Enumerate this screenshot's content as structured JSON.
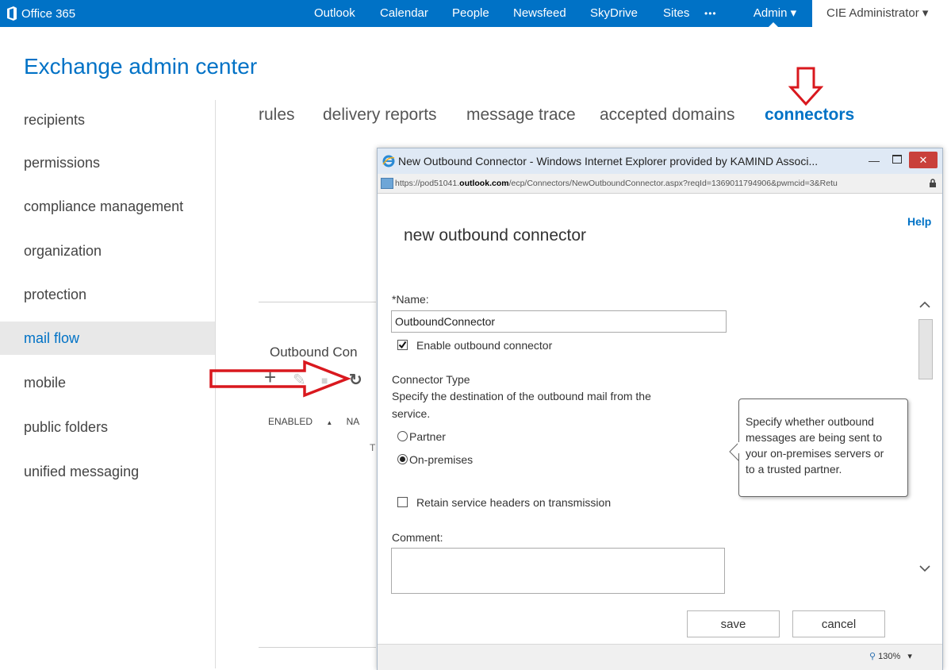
{
  "topbar": {
    "brand": "Office 365",
    "nav": [
      "Outlook",
      "Calendar",
      "People",
      "Newsfeed",
      "SkyDrive",
      "Sites",
      "•••"
    ],
    "admin_label": "Admin ▾",
    "user": "CIE Administrator ▾",
    "color": "#0072c6"
  },
  "page": {
    "title": "Exchange admin center"
  },
  "leftnav": {
    "items": [
      "recipients",
      "permissions",
      "compliance management",
      "organization",
      "protection",
      "mail flow",
      "mobile",
      "public folders",
      "unified messaging"
    ],
    "active": "mail flow"
  },
  "subnav": {
    "tabs": [
      "rules",
      "delivery reports",
      "message trace",
      "accepted domains",
      "connectors"
    ],
    "active": "connectors"
  },
  "background": {
    "section_label": "Outbound Con",
    "columns": [
      "ENABLED",
      "NA"
    ],
    "sort_icon": "sort-ascending-icon",
    "partial_text": "T"
  },
  "popup": {
    "window_title": "New Outbound Connector - Windows Internet Explorer provided by KAMIND Associ...",
    "url_prefix": "https://pod51041.",
    "url_bold": "outlook.com",
    "url_rest": "/ecp/Connectors/NewOutboundConnector.aspx?reqId=1369011794906&pwmcid=3&Retu",
    "help": "Help",
    "form_title": "new outbound connector",
    "name_label": "*Name:",
    "name_value": "OutboundConnector",
    "enable_label": "Enable outbound connector",
    "enable_checked": true,
    "type_heading": "Connector Type",
    "type_desc_1": "Specify the destination of the outbound mail from the",
    "type_desc_2": "service.",
    "radio_partner": "Partner",
    "radio_onprem": "On-premises",
    "selected_type": "On-premises",
    "retain_label": "Retain service headers on transmission",
    "retain_checked": false,
    "comment_label": "Comment:",
    "comment_value": "",
    "save": "save",
    "cancel": "cancel",
    "zoom": "130%"
  },
  "tooltip": {
    "lines": [
      "Specify whether outbound",
      "messages are being sent to",
      "your on-premises servers or",
      "to a trusted partner."
    ]
  },
  "annotation_color": "#d9181e"
}
